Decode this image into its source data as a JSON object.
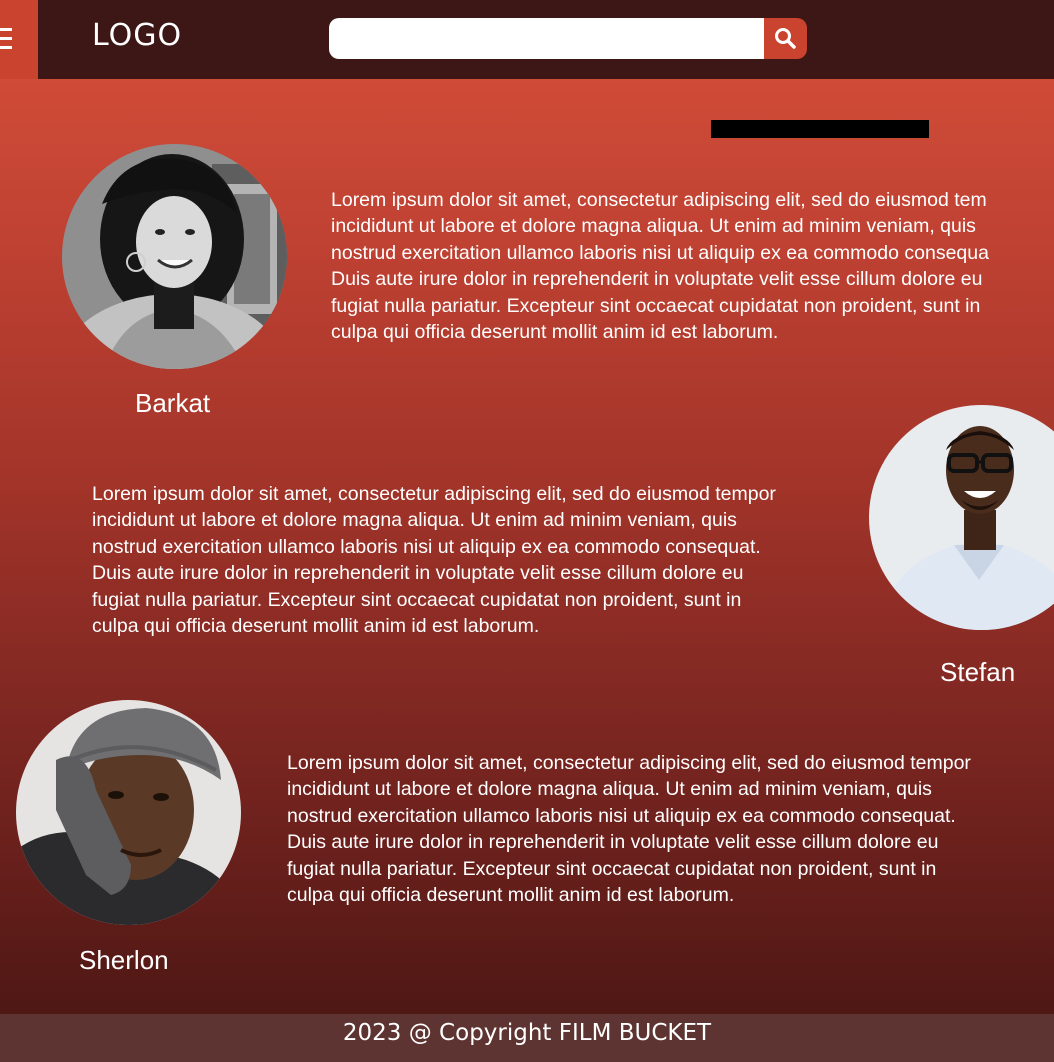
{
  "header": {
    "logo": "LOGO",
    "search": {
      "value": "",
      "placeholder": ""
    },
    "menu_icon": "hamburger-icon",
    "search_icon": "magnifier-icon"
  },
  "profiles": [
    {
      "name": "Barkat",
      "bio_lines": [
        "Lorem ipsum dolor sit amet, consectetur adipiscing elit, sed do eiusmod tem",
        "incididunt ut labore et dolore magna aliqua. Ut enim ad minim veniam, quis",
        "nostrud exercitation ullamco laboris nisi ut aliquip ex ea commodo consequa",
        "Duis aute irure dolor in reprehenderit in voluptate velit esse cillum dolore eu",
        "fugiat nulla pariatur. Excepteur sint occaecat cupidatat non proident, sunt in",
        "culpa qui officia deserunt mollit anim id est laborum."
      ]
    },
    {
      "name": "Stefan",
      "bio_lines": [
        "Lorem ipsum dolor sit amet, consectetur adipiscing elit, sed do eiusmod tempor",
        "incididunt ut labore et dolore magna aliqua. Ut enim ad minim veniam, quis",
        "nostrud exercitation ullamco laboris nisi ut aliquip ex ea commodo consequat.",
        "Duis aute irure dolor in reprehenderit in voluptate velit esse cillum dolore eu",
        "fugiat nulla pariatur. Excepteur sint occaecat cupidatat non proident, sunt in",
        "culpa qui officia deserunt mollit anim id est laborum."
      ]
    },
    {
      "name": "Sherlon",
      "bio_lines": [
        "Lorem ipsum dolor sit amet, consectetur adipiscing elit, sed do eiusmod tempor",
        "incididunt ut labore et dolore magna aliqua. Ut enim ad minim veniam, quis",
        "nostrud exercitation ullamco laboris nisi ut aliquip ex ea commodo consequat.",
        "Duis aute irure dolor in reprehenderit in voluptate velit esse cillum dolore eu",
        "fugiat nulla pariatur. Excepteur sint occaecat cupidatat non proident, sunt in",
        "culpa qui officia deserunt mollit anim id est laborum."
      ]
    }
  ],
  "footer": {
    "text": "2023 @ Copyright FILM BUCKET"
  },
  "colors": {
    "header_bg": "#3c1716",
    "accent": "#c9432f",
    "gradient_top": "#d8503a",
    "gradient_bottom": "#461512",
    "footer_bg": "#5e3432",
    "text": "#ffffff"
  }
}
